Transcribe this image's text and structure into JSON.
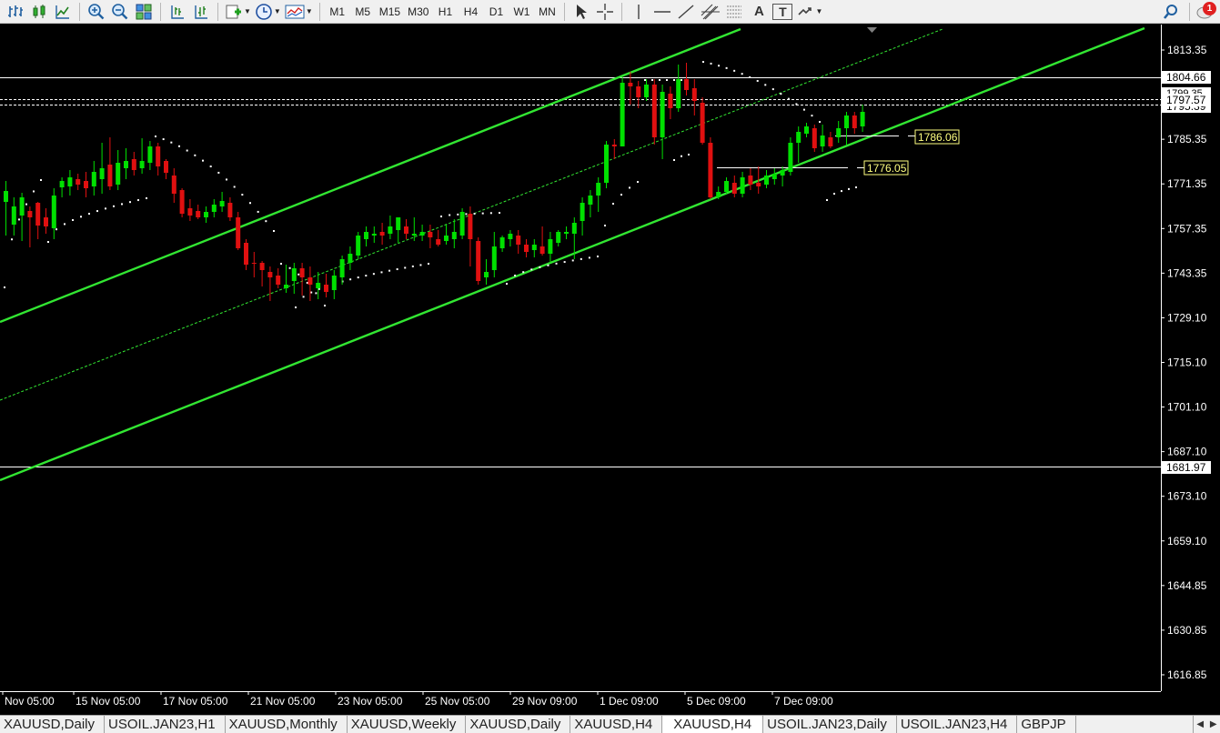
{
  "toolbar": {
    "left_icons": [
      "bar-chart-icon",
      "candlestick-icon",
      "line-chart-icon"
    ],
    "zoom_icons": [
      "zoom-in-icon",
      "zoom-out-icon",
      "tile-windows-icon"
    ],
    "nav_icons": [
      "chart-shift-icon",
      "auto-scroll-icon"
    ],
    "insert_icons": [
      "new-order-icon",
      "clock-icon",
      "templates-icon"
    ],
    "timeframes": [
      "M1",
      "M5",
      "M15",
      "M30",
      "H1",
      "H4",
      "D1",
      "W1",
      "MN"
    ],
    "draw_icons": [
      "cursor-icon",
      "crosshair-icon",
      "vertical-line-icon",
      "horizontal-line-icon",
      "trendline-icon",
      "equidistant-channel-icon",
      "fibonacci-icon",
      "text-icon",
      "text-label-icon",
      "arrows-icon"
    ],
    "text_tool_label": "A",
    "text_label_tool_label": "T",
    "right_icons": [
      "search-icon",
      "notifications-icon"
    ],
    "notification_count": "1"
  },
  "chart": {
    "price_levels": [
      "1813.35",
      "1799.35",
      "1785.35",
      "1771.35",
      "1757.35",
      "1743.35",
      "1729.10",
      "1715.10",
      "1701.10",
      "1687.10",
      "1673.10",
      "1659.10",
      "1644.85",
      "1630.85",
      "1616.85"
    ],
    "level_1804": "1804.66",
    "level_1799": "1799.35",
    "level_1797": "1797.57",
    "level_1795": "1795.39",
    "level_1681": "1681.97",
    "label_1786": "1786.06",
    "label_1776": "1776.05",
    "time_labels": [
      "Nov 05:00",
      "15 Nov 05:00",
      "17 Nov 05:00",
      "21 Nov 05:00",
      "23 Nov 05:00",
      "25 Nov 05:00",
      "29 Nov 09:00",
      "1 Dec 09:00",
      "5 Dec 09:00",
      "7 Dec 09:00"
    ],
    "colors": {
      "bull": "#00e000",
      "bear": "#e01010",
      "channel": "#32e632",
      "background": "#000000",
      "axis_text": "#ffffff",
      "label_bg": "#ffff80"
    }
  },
  "tabs": [
    "XAUUSD,Daily",
    "USOIL.JAN23,H1",
    "XAUUSD,Monthly",
    "XAUUSD,Weekly",
    "XAUUSD,Daily",
    "XAUUSD,H4",
    "XAUUSD,H4",
    "USOIL.JAN23,Daily",
    "USOIL.JAN23,H4",
    "GBPJP"
  ],
  "active_tab_index": 6,
  "tab_scroll": [
    "◀",
    "▶"
  ]
}
